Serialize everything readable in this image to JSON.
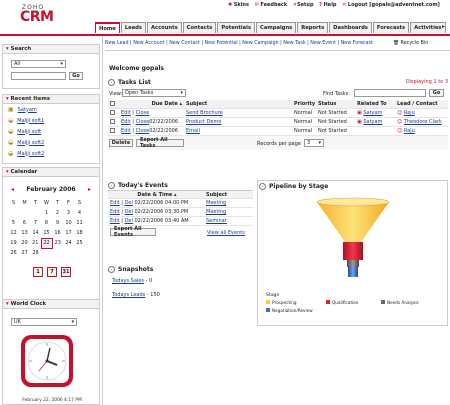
{
  "header": {
    "logo_top": "ZOHO",
    "logo_main": "CRM",
    "top_links": [
      {
        "icon": "skins-icon",
        "glyph": "✱",
        "label": "Skins"
      },
      {
        "icon": "feedback-icon",
        "glyph": "✉",
        "label": "Feedback"
      },
      {
        "icon": "setup-icon",
        "glyph": "✕",
        "label": "Setup"
      },
      {
        "icon": "help-icon",
        "glyph": "?",
        "label": "Help"
      },
      {
        "icon": "logout-icon",
        "glyph": "✕",
        "label": "Logout [gopals@adventnet.com]"
      }
    ],
    "tabs": [
      "Home",
      "Leads",
      "Accounts",
      "Contacts",
      "Potentials",
      "Campaigns",
      "Reports",
      "Dashboards",
      "Forecasts",
      "Activities"
    ],
    "active_tab": "Home",
    "more_arrow": "▸"
  },
  "toolbar": {
    "items": [
      "New Lead",
      "New Account",
      "New Contact",
      "New Potential",
      "New Campaign",
      "New Task",
      "New Event",
      "New Forecast"
    ],
    "recycle_bin": "Recycle Bin"
  },
  "sidebar": {
    "search": {
      "title": "Search",
      "select_value": "All",
      "go": "Go"
    },
    "recent": {
      "title": "Recent Items",
      "items": [
        "Satyam",
        "Maljji soft1",
        "Maljji soft",
        "Maljji soft2",
        "Maljji soft2"
      ]
    },
    "calendar": {
      "title": "Calendar",
      "month": "February 2006",
      "prev": "◂",
      "next": "▸",
      "days": [
        "S",
        "M",
        "T",
        "W",
        "T",
        "F",
        "S"
      ],
      "weeks": [
        [
          "",
          "",
          "",
          "1",
          "2",
          "3",
          "4"
        ],
        [
          "5",
          "6",
          "7",
          "8",
          "9",
          "10",
          "11"
        ],
        [
          "12",
          "13",
          "14",
          "15",
          "16",
          "17",
          "18"
        ],
        [
          "19",
          "20",
          "21",
          "22",
          "23",
          "24",
          "25"
        ],
        [
          "26",
          "27",
          "28",
          "",
          "",
          "",
          ""
        ]
      ],
      "today": "22",
      "view_icons": [
        "1",
        "7",
        "31"
      ]
    },
    "clock": {
      "title": "World Clock",
      "select_value": "UK",
      "datetime": "February 22, 2006 4:17 PM"
    }
  },
  "welcome": "Welcome gopals",
  "tasks": {
    "title": "Tasks List",
    "displaying": "Displaying 1 to 3",
    "view_label": "View:",
    "view_value": "Open Tasks",
    "find_label": "Find Tasks:",
    "go": "Go",
    "columns": [
      "",
      "Due Date",
      "Subject",
      "Priority",
      "Status",
      "Related To",
      "Lead / Contact"
    ],
    "sort_marker": "▴",
    "rows": [
      {
        "edit": "Edit",
        "close": "Close",
        "due": "",
        "subject": "Send Brochure",
        "priority": "Normal",
        "status": "Not Started",
        "related": "Satyam",
        "contact": "Raju"
      },
      {
        "edit": "Edit",
        "close": "Close",
        "due": "02/22/2006",
        "subject": "Product Demo",
        "priority": "Normal",
        "status": "Not Started",
        "related": "Satyam",
        "contact": "Theodore Clark"
      },
      {
        "edit": "Edit",
        "close": "Close",
        "due": "02/22/2006",
        "subject": "Email",
        "priority": "Normal",
        "status": "Not Started",
        "related": "",
        "contact": "Raju"
      }
    ],
    "delete": "Delete",
    "export_all": "Export All Tasks",
    "rpp_label": "Records per page",
    "rpp_value": "3"
  },
  "events": {
    "title": "Today's Events",
    "columns": [
      "Date & Time",
      "Subject"
    ],
    "sort_marker": "▴",
    "rows": [
      {
        "edit": "Edit",
        "del": "Del",
        "datetime": "02/22/2006 04:00 PM",
        "subject": "Meeting"
      },
      {
        "edit": "Edit",
        "del": "Del",
        "datetime": "02/22/2006 03:30 PM",
        "subject": "Meeting"
      },
      {
        "edit": "Edit",
        "del": "Del",
        "datetime": "02/22/2006 03:40 AM",
        "subject": "Seminar"
      }
    ],
    "export_all": "Export All Events",
    "view_all": "View all Events"
  },
  "snapshots": {
    "title": "Snapshots",
    "items": [
      {
        "label": "Todays Sales",
        "value": "0"
      },
      {
        "label": "Todays Leads",
        "value": "150"
      }
    ]
  },
  "pipeline": {
    "title": "Pipeline by Stage",
    "legend_title": "Stage",
    "legend": [
      {
        "name": "Prospecting",
        "color": "#f7d13a"
      },
      {
        "name": "Qualification",
        "color": "#e0233a"
      },
      {
        "name": "Needs Analysis",
        "color": "#6b6b6b"
      },
      {
        "name": "Negotiation/Review",
        "color": "#3a6fd0"
      }
    ]
  },
  "colors": {
    "accent": "#c8102e",
    "link": "#1a3c8c"
  }
}
